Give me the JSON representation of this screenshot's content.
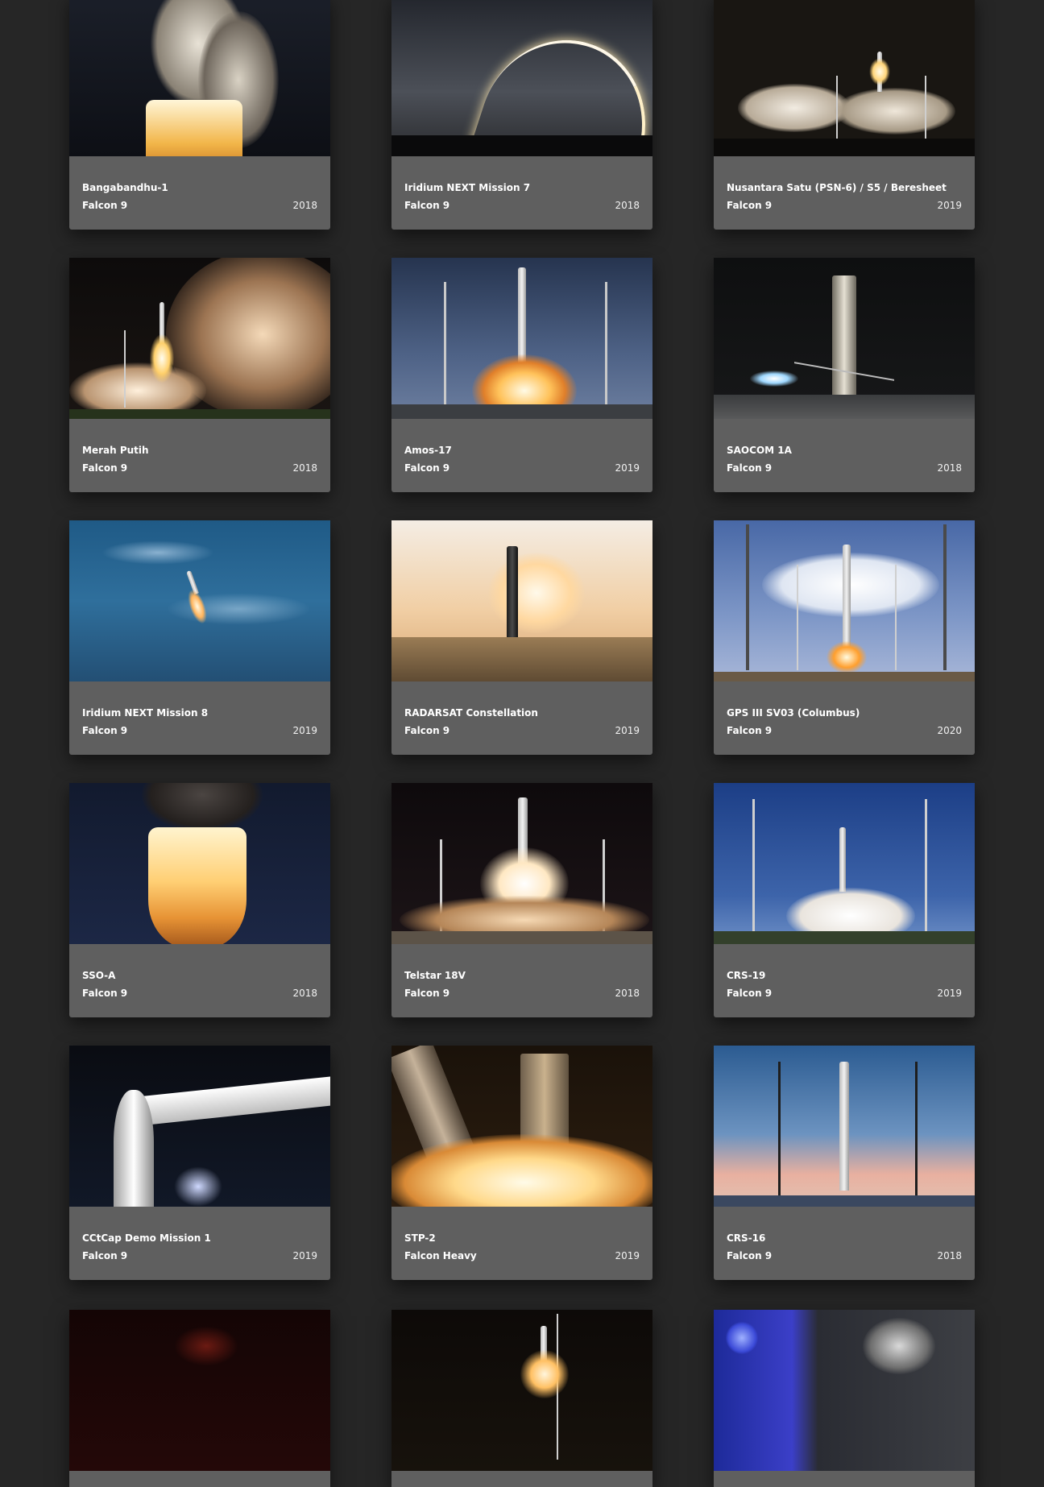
{
  "launches": [
    {
      "title": "Bangabandhu-1",
      "rocket": "Falcon 9",
      "year": "2018",
      "scene": "plume-top"
    },
    {
      "title": "Iridium NEXT Mission 7",
      "rocket": "Falcon 9",
      "year": "2018",
      "scene": "arc"
    },
    {
      "title": "Nusantara Satu (PSN-6) / S5 / Beresheet",
      "rocket": "Falcon 9",
      "year": "2019",
      "scene": "night-pad"
    },
    {
      "title": "Merah Putih",
      "rocket": "Falcon 9",
      "year": "2018",
      "scene": "night-cloud"
    },
    {
      "title": "Amos-17",
      "rocket": "Falcon 9",
      "year": "2019",
      "scene": "blue-liftoff"
    },
    {
      "title": "SAOCOM 1A",
      "rocket": "Falcon 9",
      "year": "2018",
      "scene": "landing"
    },
    {
      "title": "Iridium NEXT Mission 8",
      "rocket": "Falcon 9",
      "year": "2019",
      "scene": "sky-flight"
    },
    {
      "title": "RADARSAT Constellation",
      "rocket": "Falcon 9",
      "year": "2019",
      "scene": "sunset-pad"
    },
    {
      "title": "GPS III SV03 (Columbus)",
      "rocket": "Falcon 9",
      "year": "2020",
      "scene": "day-liftoff"
    },
    {
      "title": "SSO-A",
      "rocket": "Falcon 9",
      "year": "2018",
      "scene": "engine-fire"
    },
    {
      "title": "Telstar 18V",
      "rocket": "Falcon 9",
      "year": "2018",
      "scene": "night-liftoff"
    },
    {
      "title": "CRS-19",
      "rocket": "Falcon 9",
      "year": "2019",
      "scene": "blue-smoke"
    },
    {
      "title": "CCtCap Demo Mission 1",
      "rocket": "Falcon 9",
      "year": "2019",
      "scene": "crew-arm"
    },
    {
      "title": "STP-2",
      "rocket": "Falcon Heavy",
      "year": "2019",
      "scene": "fh-fire"
    },
    {
      "title": "CRS-16",
      "rocket": "Falcon 9",
      "year": "2018",
      "scene": "dusk-pad"
    }
  ],
  "partial_row": [
    {
      "scene": "dark-red"
    },
    {
      "scene": "night-glow"
    },
    {
      "scene": "capsule"
    }
  ]
}
